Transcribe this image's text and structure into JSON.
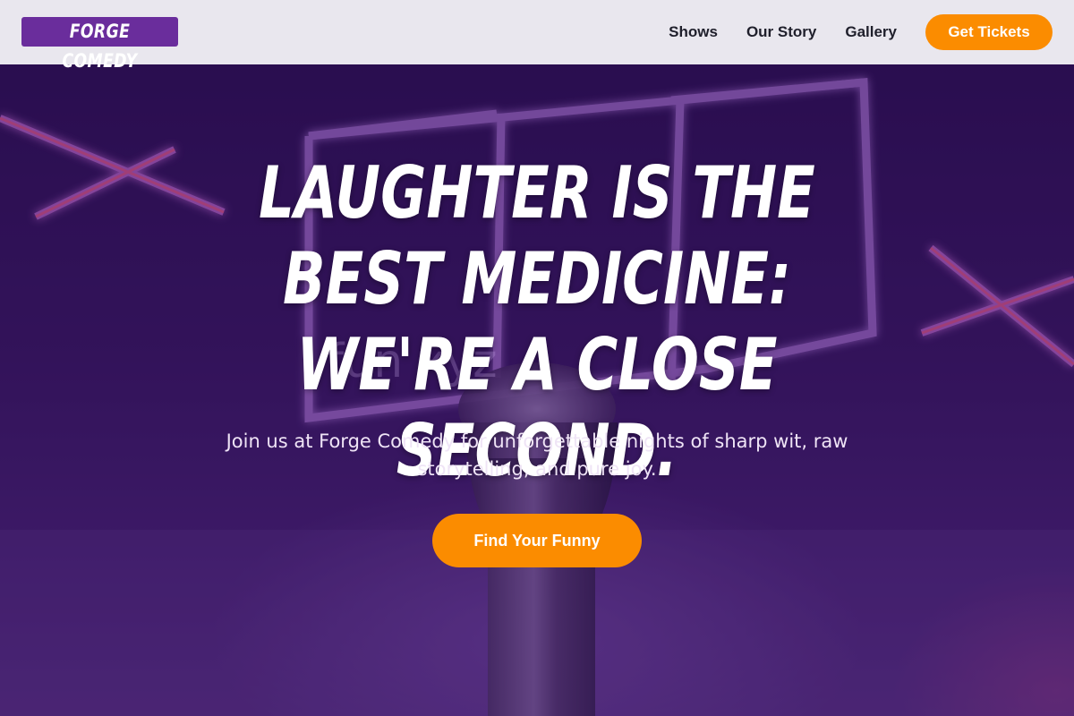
{
  "brand": {
    "logo_text": "FORGE COMEDY",
    "logo_bg": "#6a2d9c"
  },
  "nav": {
    "links": [
      {
        "label": "Shows"
      },
      {
        "label": "Our Story"
      },
      {
        "label": "Gallery"
      }
    ],
    "cta_label": "Get Tickets"
  },
  "hero": {
    "title": "Laughter is the best medicine: we're a close second.",
    "subtitle": "Join us at Forge Comedy for unforgettable nights of sharp wit, raw storytelling, and pure joy.",
    "cta_label": "Find Your Funny",
    "watermark": "fun        xyz"
  },
  "colors": {
    "nav_bg": "#e9e7ee",
    "accent": "#fb8c00",
    "hero_overlay": "#3a1763",
    "neon": "#c98bf2"
  }
}
